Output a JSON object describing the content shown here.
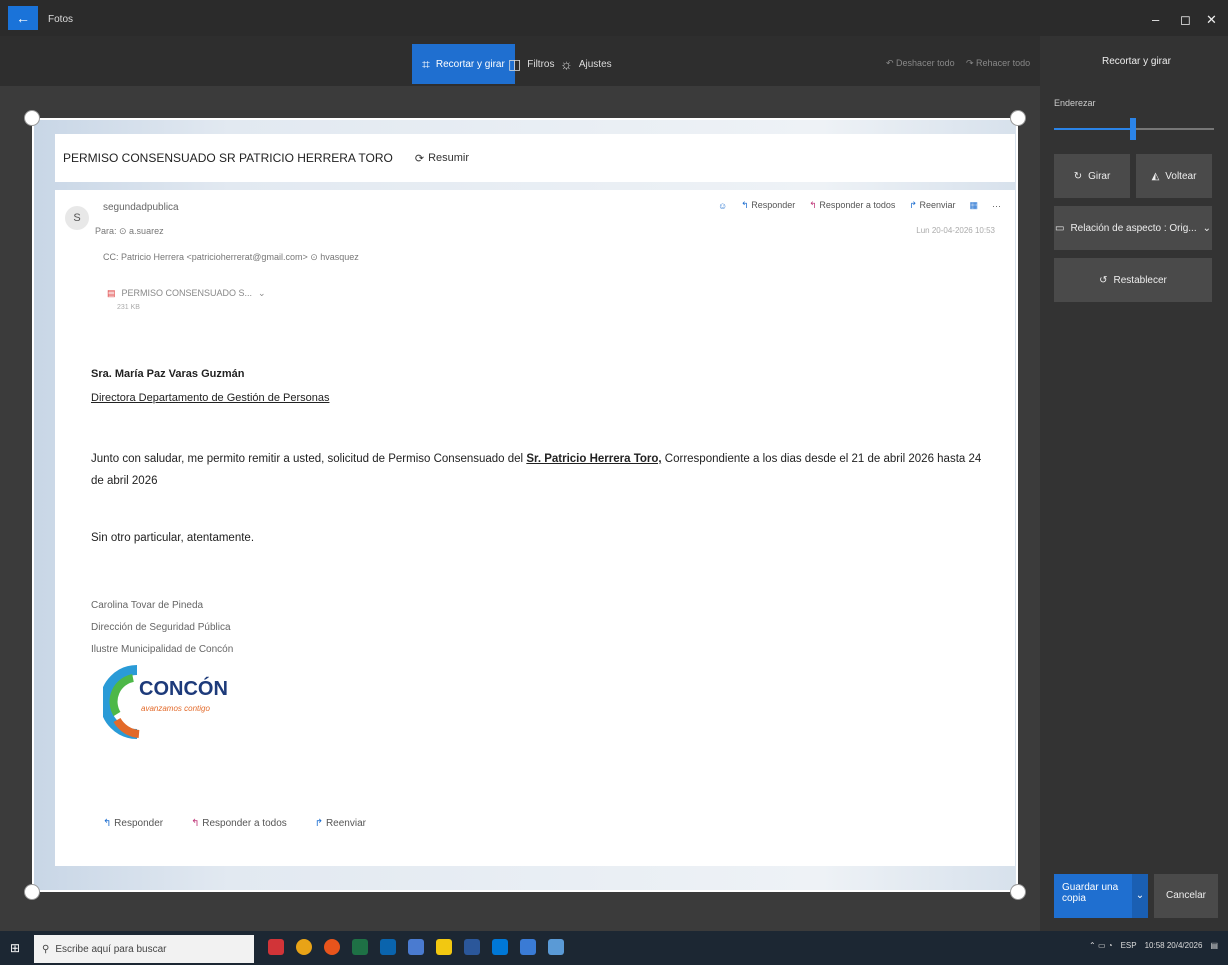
{
  "app": {
    "title": "Fotos",
    "back_glyph": "←"
  },
  "window_controls": {
    "minimize": "–",
    "maximize": "◻",
    "close": "✕"
  },
  "toolbar": {
    "tabs": [
      {
        "label": "Recortar y girar",
        "icon": "crop-icon",
        "active": true
      },
      {
        "label": "Filtros",
        "icon": "filters-icon",
        "active": false
      },
      {
        "label": "Ajustes",
        "icon": "adjust-icon",
        "active": false
      }
    ],
    "undo_label": "Deshacer todo",
    "redo_label": "Rehacer todo"
  },
  "side_panel": {
    "title": "Recortar y girar",
    "straighten_label": "Enderezar",
    "straighten_value": 0.5,
    "rotate_label": "Girar",
    "flip_label": "Voltear",
    "aspect_label": "Relación de aspecto : Orig...",
    "reset_label": "Restablecer",
    "save_label": "Guardar una copia",
    "cancel_label": "Cancelar"
  },
  "email": {
    "subject": "PERMISO CONSENSUADO SR PATRICIO HERRERA TORO",
    "resumir_label": "Resumir",
    "avatar_letter": "S",
    "sender": "segundadpublica",
    "to": "Para: ⊙ a.suarez",
    "cc": "CC: Patricio Herrera <patricioherrerat@gmail.com>  ⊙ hvasquez",
    "date": "Lun 20-04-2026 10:53",
    "actions": {
      "reply": "Responder",
      "reply_all": "Responder a todos",
      "forward": "Reenviar"
    },
    "attachment_name": "PERMISO CONSENSUADO S...",
    "attachment_size": "231 KB",
    "recipient_name": "Sra. María Paz Varas Guzmán",
    "recipient_title": "Directora Departamento de Gestión de Personas",
    "body_pre": "Junto con saludar, me permito remitir a usted, solicitud de Permiso Consensuado del ",
    "body_bold": "Sr. Patricio Herrera Toro,",
    "body_post": " Correspondiente a los dias desde el 21 de abril 2026 hasta 24 de abril 2026",
    "closing": "Sin otro particular, atentamente.",
    "signature": [
      "Carolina Tovar de Pineda",
      "Dirección de Seguridad Pública",
      "Ilustre Municipalidad de Concón"
    ],
    "logo_text": "CONCÓN",
    "logo_sub": "avanzamos contigo"
  },
  "taskbar": {
    "search_placeholder": "Escribe aquí para buscar",
    "lang": "ESP",
    "time": "10:58",
    "date": "20/4/2026"
  },
  "colors": {
    "accent": "#1f6fd0",
    "reply_all": "#c0397a",
    "dark_bg": "#2e2e2e"
  }
}
